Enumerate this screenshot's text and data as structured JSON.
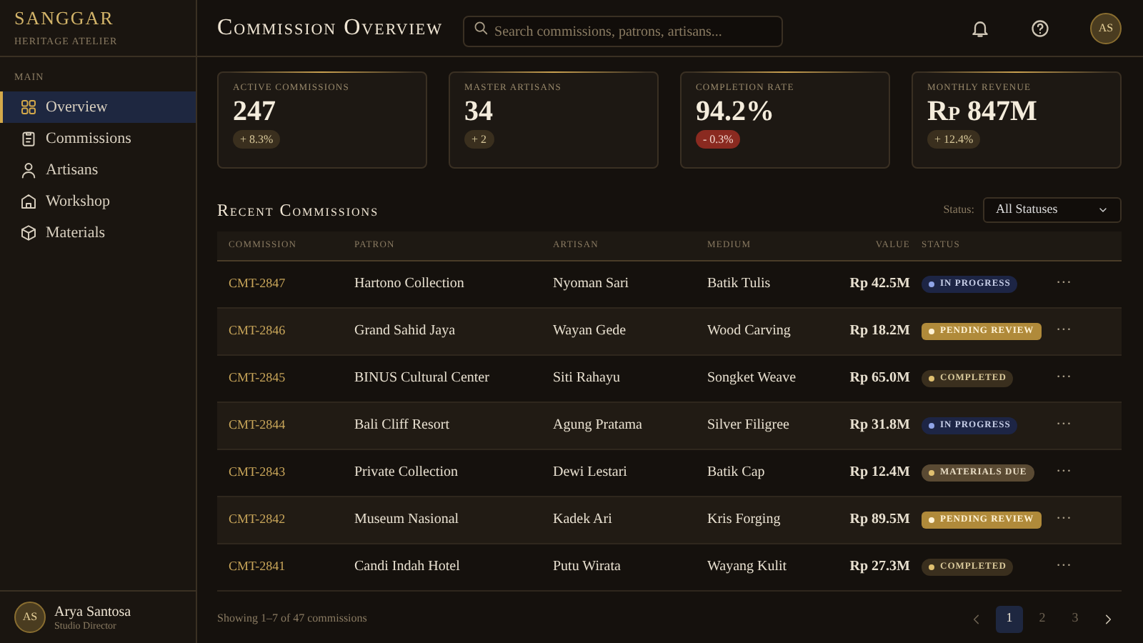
{
  "brand": {
    "name": "SANGGAR",
    "tagline": "HERITAGE ATELIER"
  },
  "sidebar": {
    "section": "MAIN",
    "items": [
      {
        "label": "Overview",
        "selected": true
      },
      {
        "label": "Commissions",
        "selected": false
      },
      {
        "label": "Artisans",
        "selected": false
      },
      {
        "label": "Workshop",
        "selected": false
      },
      {
        "label": "Materials",
        "selected": false
      }
    ]
  },
  "user": {
    "initials": "AS",
    "name": "Arya Santosa",
    "role": "Studio Director"
  },
  "header": {
    "title": "Commission Overview",
    "search": {
      "placeholder": "Search commissions, patrons, artisans..."
    },
    "avatar": "AS"
  },
  "stats": [
    {
      "label": "ACTIVE COMMISSIONS",
      "value": "247",
      "delta": "+ 8.3%",
      "kind": "up"
    },
    {
      "label": "MASTER ARTISANS",
      "value": "34",
      "delta": "+ 2",
      "kind": "up"
    },
    {
      "label": "COMPLETION RATE",
      "value": "94.2%",
      "delta": "- 0.3%",
      "kind": "down"
    },
    {
      "label": "MONTHLY REVENUE",
      "value": "Rp 847M",
      "delta": "+ 12.4%",
      "kind": "up"
    }
  ],
  "table": {
    "title": "Recent Commissions",
    "filter": {
      "label": "Status:",
      "value": "All Statuses"
    },
    "columns": [
      "COMMISSION",
      "PATRON",
      "ARTISAN",
      "MEDIUM",
      "VALUE",
      "STATUS"
    ],
    "rows": [
      {
        "id": "CMT-2847",
        "patron": "Hartono Collection",
        "artisan": "Nyoman Sari",
        "medium": "Batik Tulis",
        "value": "Rp 42.5M",
        "status": "IN PROGRESS",
        "kind": "progress"
      },
      {
        "id": "CMT-2846",
        "patron": "Grand Sahid Jaya",
        "artisan": "Wayan Gede",
        "medium": "Wood Carving",
        "value": "Rp 18.2M",
        "status": "PENDING REVIEW",
        "kind": "pending"
      },
      {
        "id": "CMT-2845",
        "patron": "BINUS Cultural Center",
        "artisan": "Siti Rahayu",
        "medium": "Songket Weave",
        "value": "Rp 65.0M",
        "status": "COMPLETED",
        "kind": "completed"
      },
      {
        "id": "CMT-2844",
        "patron": "Bali Cliff Resort",
        "artisan": "Agung Pratama",
        "medium": "Silver Filigree",
        "value": "Rp 31.8M",
        "status": "IN PROGRESS",
        "kind": "progress"
      },
      {
        "id": "CMT-2843",
        "patron": "Private Collection",
        "artisan": "Dewi Lestari",
        "medium": "Batik Cap",
        "value": "Rp 12.4M",
        "status": "MATERIALS DUE",
        "kind": "materials"
      },
      {
        "id": "CMT-2842",
        "patron": "Museum Nasional",
        "artisan": "Kadek Ari",
        "medium": "Kris Forging",
        "value": "Rp 89.5M",
        "status": "PENDING REVIEW",
        "kind": "pending"
      },
      {
        "id": "CMT-2841",
        "patron": "Candi Indah Hotel",
        "artisan": "Putu Wirata",
        "medium": "Wayang Kulit",
        "value": "Rp 27.3M",
        "status": "COMPLETED",
        "kind": "completed"
      }
    ],
    "action": "···"
  },
  "footer": {
    "summary": "Showing 1–7 of 47 commissions",
    "pages": [
      {
        "label": "1",
        "selected": true
      },
      {
        "label": "2",
        "selected": false
      },
      {
        "label": "3",
        "selected": false
      }
    ]
  }
}
